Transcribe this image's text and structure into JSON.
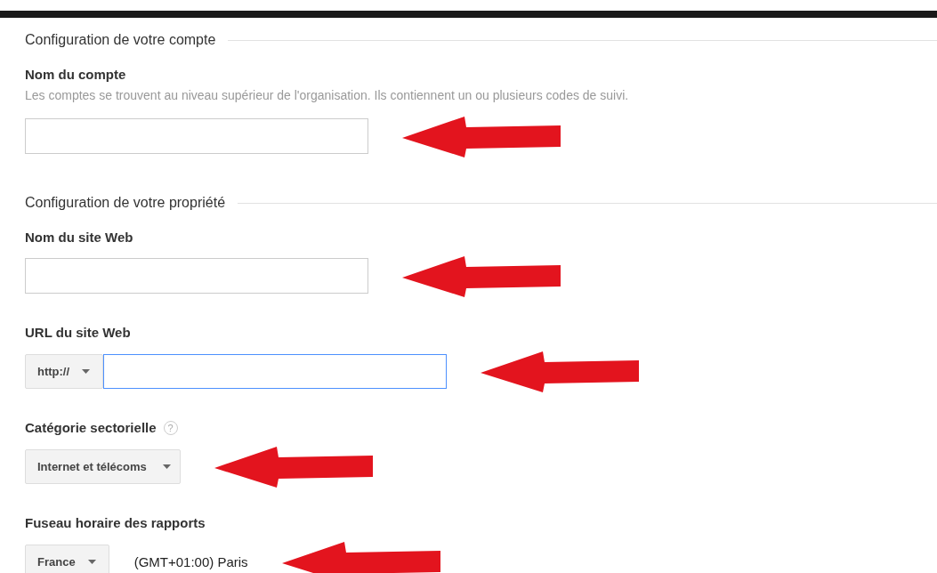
{
  "sections": [
    {
      "title": "Configuration de votre compte",
      "fields": [
        {
          "kind": "text",
          "label": "Nom du compte",
          "hint": "Les comptes se trouvent au niveau supérieur de l'organisation. Ils contiennent un ou plusieurs codes de suivi.",
          "focused": false
        }
      ]
    },
    {
      "title": "Configuration de votre propriété",
      "fields": [
        {
          "kind": "text",
          "label": "Nom du site Web",
          "focused": false
        },
        {
          "kind": "url",
          "label": "URL du site Web",
          "protocol": "http://",
          "focused": true
        },
        {
          "kind": "select",
          "label": "Catégorie sectorielle",
          "help": "?",
          "value": "Internet et télécoms"
        },
        {
          "kind": "timezone",
          "label": "Fuseau horaire des rapports",
          "country": "France",
          "zone": "(GMT+01:00) Paris"
        }
      ]
    }
  ]
}
